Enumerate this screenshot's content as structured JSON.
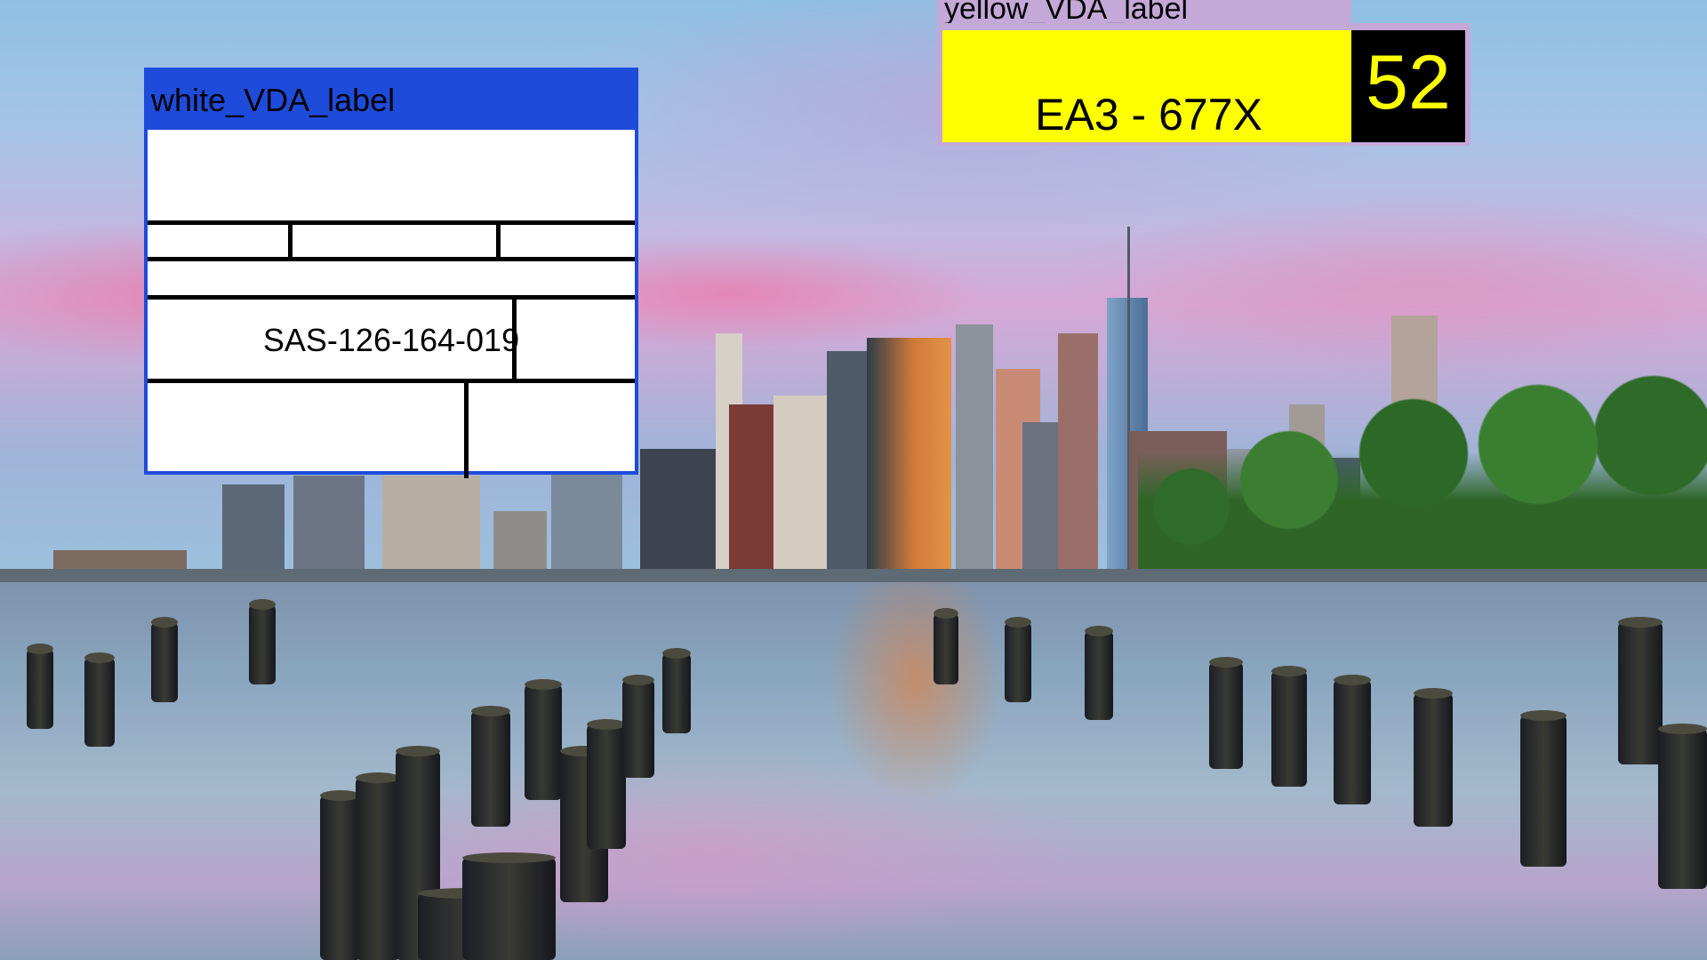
{
  "labels": {
    "white_label": {
      "title": "white_VDA_label",
      "serial": "SAS-126-164-019",
      "header_color": "#1f4bdb"
    },
    "yellow_label": {
      "title": "yellow_VDA_label",
      "plate_text": "EA3 - 677X",
      "number": "52",
      "plate_color": "#ffff00",
      "number_box_color": "#000000",
      "header_color": "#c4a8d8"
    }
  },
  "background": {
    "description_icon": "city-skyline-photo-icon"
  }
}
